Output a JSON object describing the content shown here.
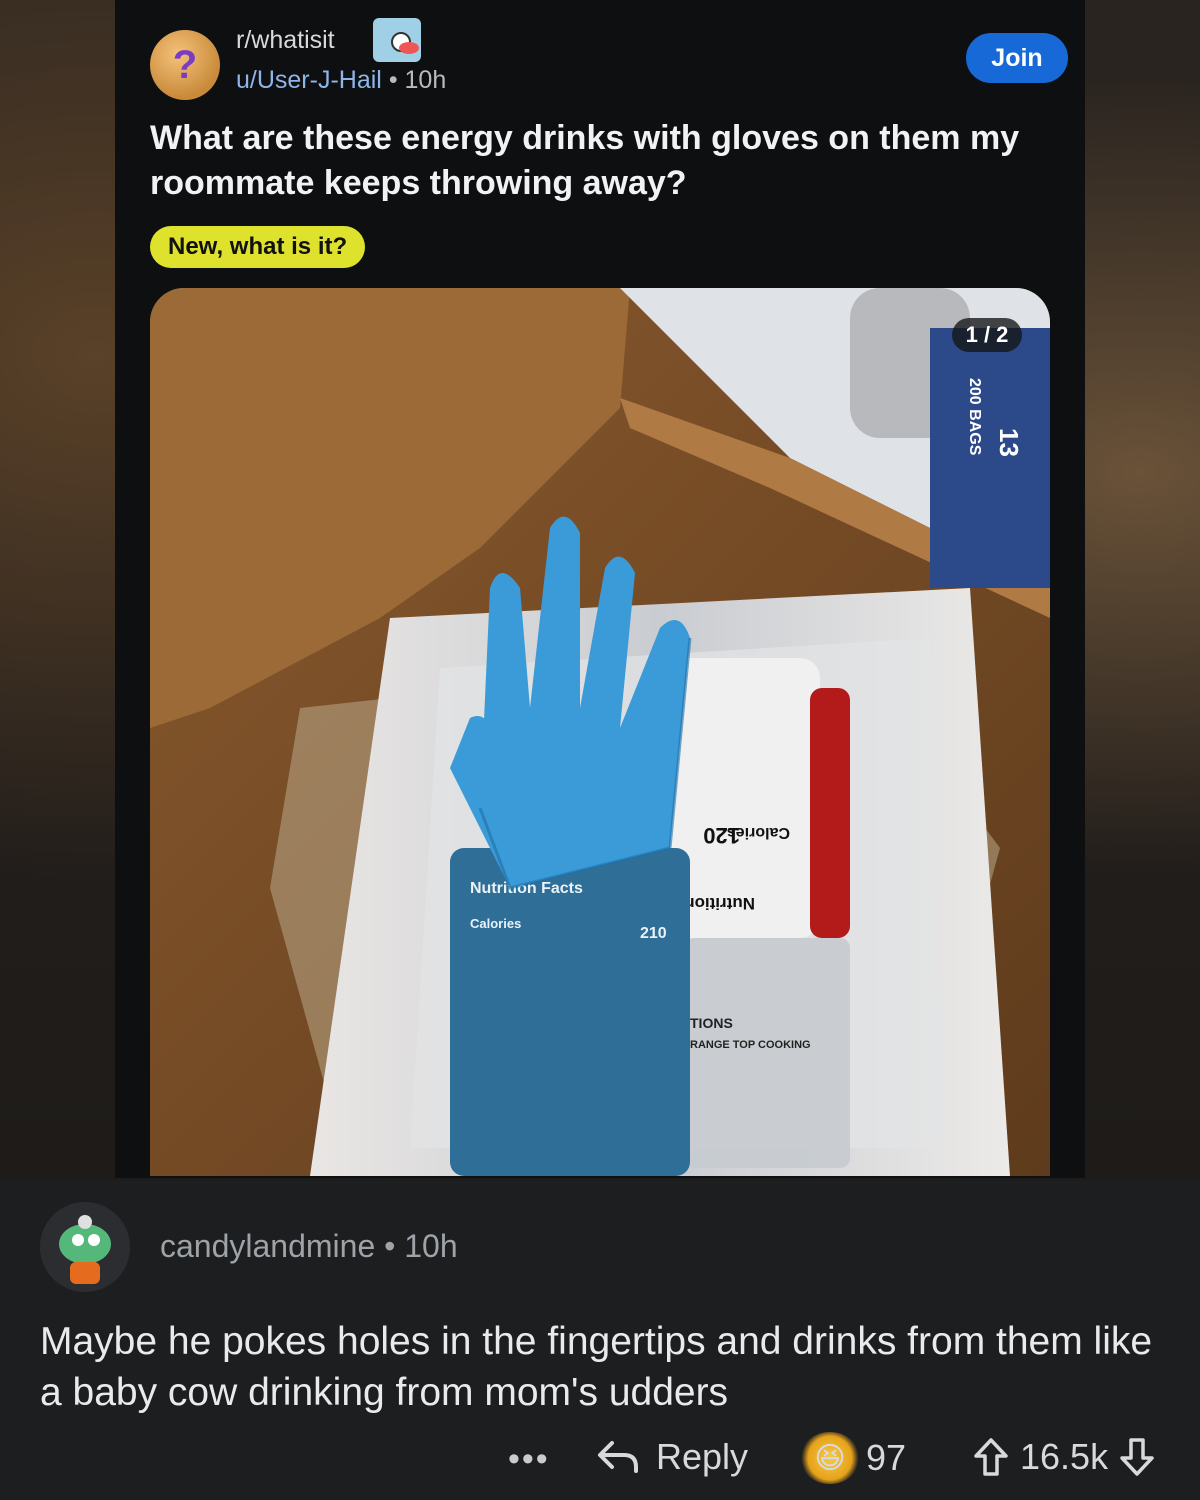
{
  "post": {
    "subreddit": "r/whatisit",
    "author": "u/User-J-Hail",
    "separator": "•",
    "time": "10h",
    "join_label": "Join",
    "title": "What are these energy drinks with gloves on them my roommate keeps throwing away?",
    "flair": "New, what is it?",
    "image_page": "1 / 2",
    "image_text": {
      "can_panel": "Nutrition Facts",
      "can_calories": "Calories",
      "can_value": "210",
      "box_bag_count": "200 BAGS",
      "box_number": "13",
      "bottle_panel": "Nutrition Facts",
      "bottle_calories": "Calories",
      "bottle_value": "120",
      "instructions_heading": "TIONS",
      "instructions_line": "RANGE TOP COOKING"
    }
  },
  "comment": {
    "author": "candylandmine",
    "separator": "•",
    "time": "10h",
    "body": "Maybe he pokes holes in the fingertips and drinks from them like a baby cow drinking from mom's udders",
    "more_label": "•••",
    "reply_label": "Reply",
    "award_count": "97",
    "vote_count": "16.5k"
  },
  "icons": {
    "reply": "reply-arrow-icon",
    "upvote": "upvote-arrow-icon",
    "downvote": "downvote-arrow-icon",
    "award": "laughing-award-icon"
  },
  "colors": {
    "join_button": "#1669d6",
    "flair_background": "#dfe22c",
    "author_link": "#8fb4e8",
    "glove": "#3a9bd8"
  }
}
